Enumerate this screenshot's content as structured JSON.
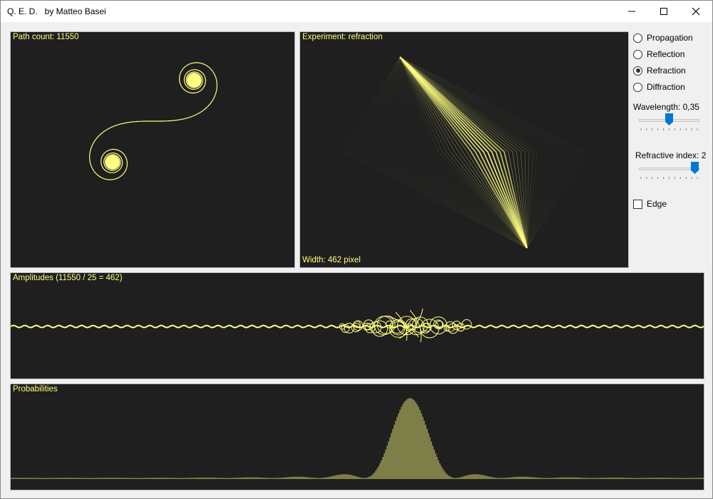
{
  "window": {
    "title": "Q. E. D.   by Matteo Basei"
  },
  "panels": {
    "paths": {
      "label": "Path count: 11550"
    },
    "experiment": {
      "label": "Experiment: refraction",
      "footer": "Width: 462 pixel"
    },
    "amplitudes": {
      "label": "Amplitudes (11550 / 25 = 462)"
    },
    "probabilities": {
      "label": "Probabilities"
    }
  },
  "controls": {
    "modes": [
      {
        "label": "Propagation",
        "selected": false
      },
      {
        "label": "Reflection",
        "selected": false
      },
      {
        "label": "Refraction",
        "selected": true
      },
      {
        "label": "Diffraction",
        "selected": false
      }
    ],
    "wavelength": {
      "label": "Wavelength: 0,35",
      "value": 0.35
    },
    "refractive_index": {
      "label": "Refractive index: 2",
      "value": 2
    },
    "edge": {
      "label": "Edge",
      "checked": false
    }
  },
  "colors": {
    "plot_background": "#1f1f1f",
    "trace": "#ffff80",
    "accent": "#0078d7"
  }
}
